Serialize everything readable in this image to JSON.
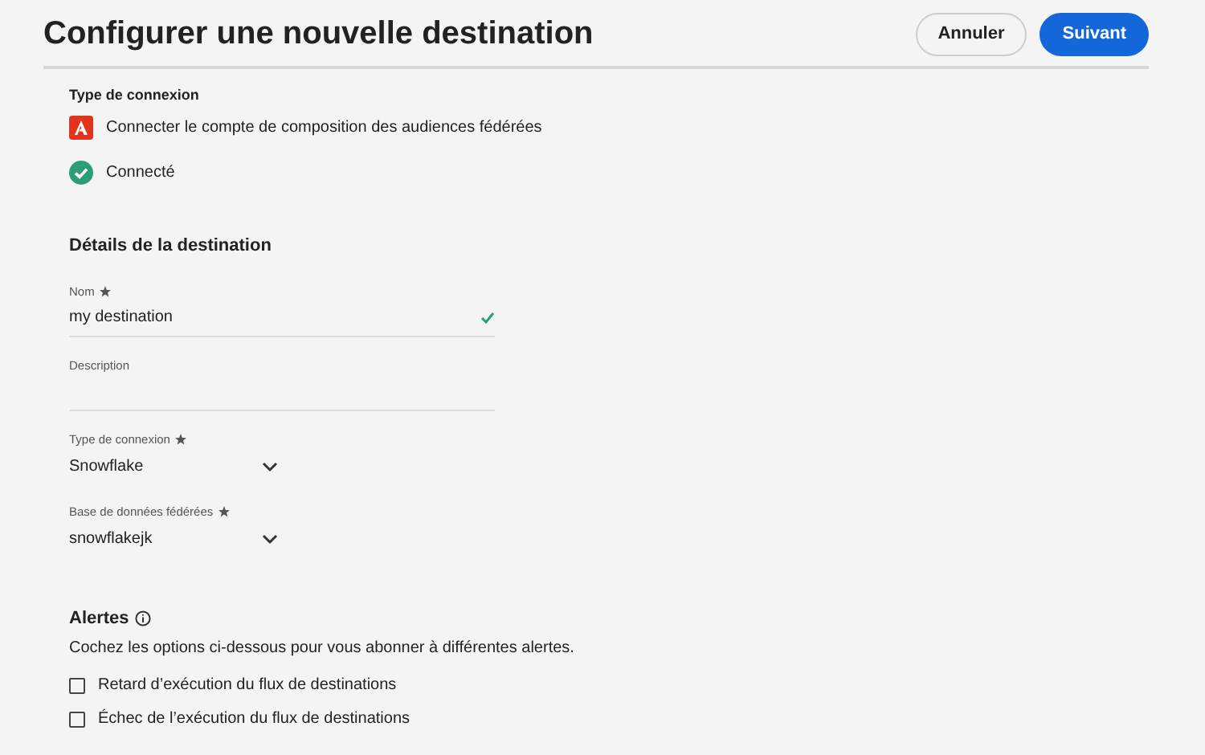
{
  "header": {
    "title": "Configurer une nouvelle destination",
    "buttons": [
      {
        "label": "Annuler",
        "kind": "secondary"
      },
      {
        "label": "Suivant",
        "kind": "primary"
      }
    ]
  },
  "connection": {
    "heading": "Type de connexion",
    "account": "Connecter le compte de composition des audiences fédérées",
    "status": "Connecté"
  },
  "details": {
    "heading": "Détails de la destination",
    "fields": [
      {
        "kind": "text",
        "label": "Nom",
        "required": true,
        "value": "my destination",
        "valid": true
      },
      {
        "kind": "text",
        "label": "Description",
        "required": false,
        "valid": false
      },
      {
        "kind": "select",
        "label": "Type de connexion",
        "required": true,
        "value": "Snowflake"
      },
      {
        "kind": "select",
        "label": "Base de données fédérées",
        "required": true,
        "value": "snowflakejk"
      }
    ]
  },
  "alerts": {
    "heading": "Alertes",
    "description": "Cochez les options ci-dessous pour vous abonner à différentes alertes.",
    "options": [
      {
        "label": "Retard d’exécution du flux de destinations",
        "checked": false
      },
      {
        "label": "Échec de l’exécution du flux de destinations",
        "checked": false
      }
    ]
  }
}
